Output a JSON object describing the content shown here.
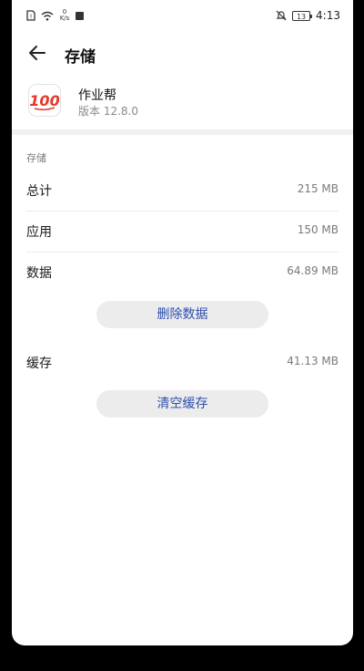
{
  "status_bar": {
    "speed_value": "0",
    "speed_unit": "K/s",
    "battery": "13",
    "time": "4:13"
  },
  "header": {
    "title": "存储"
  },
  "app": {
    "name": "作业帮",
    "version": "版本 12.8.0",
    "icon_text": "100"
  },
  "storage": {
    "section_label": "存储",
    "rows": [
      {
        "label": "总计",
        "value": "215 MB"
      },
      {
        "label": "应用",
        "value": "150 MB"
      },
      {
        "label": "数据",
        "value": "64.89 MB"
      }
    ],
    "delete_data_label": "删除数据",
    "cache_label": "缓存",
    "cache_value": "41.13 MB",
    "clear_cache_label": "清空缓存"
  }
}
